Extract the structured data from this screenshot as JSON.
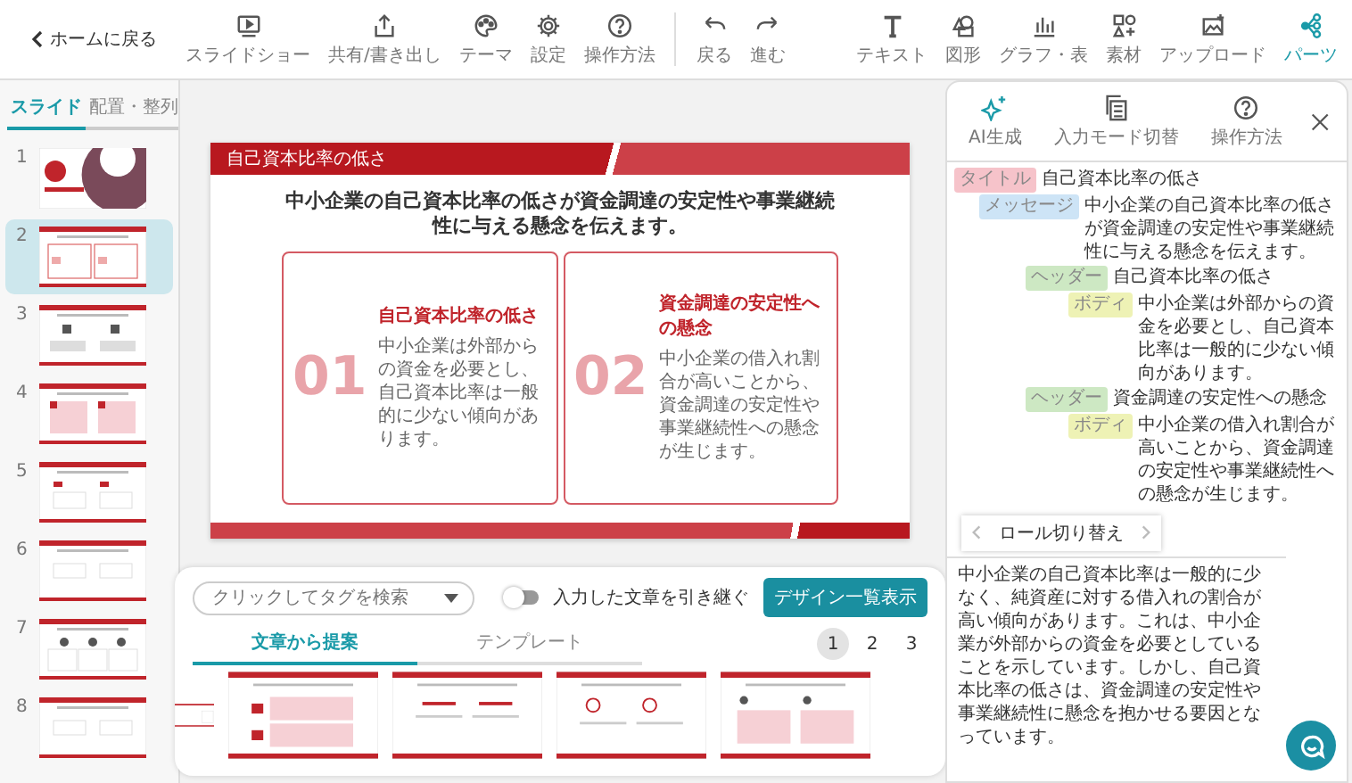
{
  "header": {
    "back": "ホームに戻る",
    "left_tools": [
      {
        "label": "スライドショー"
      },
      {
        "label": "共有/書き出し"
      },
      {
        "label": "テーマ"
      },
      {
        "label": "設定"
      },
      {
        "label": "操作方法"
      },
      {
        "label": "戻る"
      },
      {
        "label": "進む"
      }
    ],
    "right_tools": [
      {
        "label": "テキスト",
        "selected": false
      },
      {
        "label": "図形",
        "selected": false
      },
      {
        "label": "グラフ・表",
        "selected": false
      },
      {
        "label": "素材",
        "selected": false
      },
      {
        "label": "アップロード",
        "selected": false
      },
      {
        "label": "パーツ",
        "selected": true
      }
    ]
  },
  "sidebar": {
    "tabs": [
      {
        "label": "スライド",
        "selected": true
      },
      {
        "label": "配置・整列",
        "selected": false
      }
    ],
    "slides": [
      {
        "number": "1",
        "kind": "cover",
        "selected": false
      },
      {
        "number": "2",
        "kind": "cards",
        "selected": true
      },
      {
        "number": "3",
        "kind": "icons",
        "selected": false
      },
      {
        "number": "4",
        "kind": "pink",
        "selected": false
      },
      {
        "number": "5",
        "kind": "tagged",
        "selected": false
      },
      {
        "number": "6",
        "kind": "plain",
        "selected": false
      },
      {
        "number": "7",
        "kind": "people",
        "selected": false
      },
      {
        "number": "8",
        "kind": "plain",
        "selected": false
      }
    ]
  },
  "slide": {
    "title": "自己資本比率の低さ",
    "message": "中小企業の自己資本比率の低さが資金調達の安定性や事業継続性に与える懸念を伝えます。",
    "cards": [
      {
        "number": "01",
        "heading": "自己資本比率の低さ",
        "body": "中小企業は外部からの資金を必要とし、自己資本比率は一般的に少ない傾向があります。"
      },
      {
        "number": "02",
        "heading": "資金調達の安定性への懸念",
        "body": "中小企業の借入れ割合が高いことから、資金調達の安定性や事業継続性への懸念が生じます。"
      }
    ]
  },
  "suggestions": {
    "search": {
      "placeholder": "クリックしてタグを検索"
    },
    "toggle": {
      "label": "入力した文章を引き継ぐ",
      "on": false
    },
    "button": "デザイン一覧表示",
    "tabs": [
      {
        "label": "文章から提案",
        "selected": true
      },
      {
        "label": "テンプレート",
        "selected": false
      }
    ],
    "pages": [
      {
        "label": "1",
        "selected": true
      },
      {
        "label": "2",
        "selected": false
      },
      {
        "label": "3",
        "selected": false
      }
    ],
    "designs": [
      {
        "kind": "partial"
      },
      {
        "kind": "rows"
      },
      {
        "kind": "plain"
      },
      {
        "kind": "icons"
      },
      {
        "kind": "pink"
      }
    ]
  },
  "panel": {
    "tools": [
      {
        "label": "AI生成"
      },
      {
        "label": "入力モード切替"
      },
      {
        "label": "操作方法"
      }
    ],
    "outline": [
      {
        "tag": "タイトル",
        "kind": "title",
        "text": "自己資本比率の低さ",
        "children": [
          {
            "tag": "メッセージ",
            "kind": "message",
            "text": "中小企業の自己資本比率の低さが資金調達の安定性や事業継続性に与える懸念を伝えます。",
            "children": [
              {
                "tag": "ヘッダー",
                "kind": "header",
                "text": "自己資本比率の低さ",
                "children": [
                  {
                    "tag": "ボディ",
                    "kind": "body",
                    "text": "中小企業は外部からの資金を必要とし、自己資本比率は一般的に少ない傾向があります。"
                  }
                ]
              },
              {
                "tag": "ヘッダー",
                "kind": "header",
                "text": "資金調達の安定性への懸念",
                "children": [
                  {
                    "tag": "ボディ",
                    "kind": "body",
                    "text": "中小企業の借入れ割合が高いことから、資金調達の安定性や事業継続性への懸念が生じます。"
                  }
                ]
              }
            ]
          }
        ]
      }
    ],
    "role_switch": "ロール切り替え",
    "text": "中小企業の自己資本比率は一般的に少なく、純資産に対する借入れの割合が高い傾向があります。これは、中小企業が外部からの資金を必要としていることを示しています。しかし、自己資本比率の低さは、資金調達の安定性や事業継続性に懸念を抱かせる要因となっています。"
  }
}
